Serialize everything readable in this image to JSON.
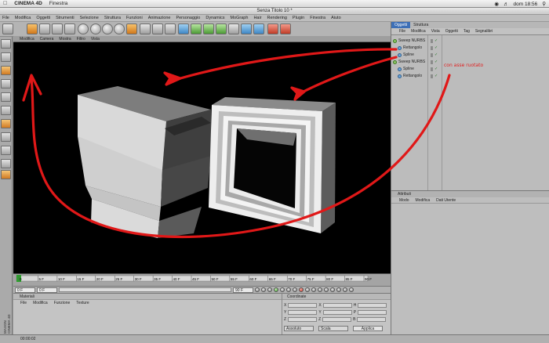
{
  "mac_menubar": {
    "apple": "",
    "app_name": "CINEMA 4D",
    "menu": "Finestra",
    "clock": "dom 18:56"
  },
  "window": {
    "title": "Senza Titolo 10 *"
  },
  "app_menu": [
    "File",
    "Modifica",
    "Oggetti",
    "Strumenti",
    "Selezione",
    "Struttura",
    "Funzioni",
    "Animazione",
    "Personaggio",
    "Dynamics",
    "MoGraph",
    "Hair",
    "Rendering",
    "Plugin",
    "Finestra",
    "Aiuto"
  ],
  "viewport_menu": [
    "Modifica",
    "Camera",
    "Mostra",
    "Filtro",
    "Vista"
  ],
  "timeline": {
    "ticks": [
      "0",
      "5 F",
      "10 F",
      "15 F",
      "20 F",
      "25 F",
      "30 F",
      "35 F",
      "40 F",
      "45 F",
      "50 F",
      "55 F",
      "60 F",
      "65 F",
      "70 F",
      "75 F",
      "80 F",
      "85 F",
      "90 F"
    ],
    "current_field": "0 F",
    "start_field": "0 F",
    "end_field": "90 F",
    "current_frame": 0
  },
  "materials": {
    "title": "Materiali",
    "menu": [
      "File",
      "Modifica",
      "Funzione",
      "Texture"
    ]
  },
  "coordinates": {
    "title": "Coordinate",
    "rows": [
      {
        "a": "X",
        "b": "X",
        "c": "H"
      },
      {
        "a": "Y",
        "b": "Y",
        "c": "P"
      },
      {
        "a": "Z",
        "b": "Z",
        "c": "B"
      }
    ],
    "mode_select": "Assoluto",
    "size_select": "Scala",
    "apply_button": "Applica"
  },
  "objects": {
    "tabs": [
      "Oggetti",
      "Struttura"
    ],
    "menu": [
      "File",
      "Modifica",
      "Vista",
      "Oggetti",
      "Tag",
      "Segnalibri"
    ],
    "rows": [
      {
        "name": "Sweep NURBS",
        "level": 0,
        "icon": "sweep-nurbs-icon"
      },
      {
        "name": "Rettangolo",
        "level": 1,
        "icon": "spline-icon"
      },
      {
        "name": "Spline",
        "level": 1,
        "icon": "spline-icon"
      },
      {
        "name": "Sweep NURBS",
        "level": 0,
        "icon": "sweep-nurbs-icon"
      },
      {
        "name": "Spline",
        "level": 1,
        "icon": "spline-icon"
      },
      {
        "name": "Rettangolo",
        "level": 1,
        "icon": "spline-icon"
      }
    ]
  },
  "attributes": {
    "title": "Attributi",
    "menu": [
      "Modo",
      "Modifica",
      "Dati Utente"
    ]
  },
  "statusbar": {
    "time": "00:00:02"
  },
  "logo": "MAXON CINEMA 4D",
  "annotation": "con asse ruotato",
  "colors": {
    "annotation": "#e02020",
    "active_tab": "#3d6fb6",
    "viewport_bg": "#000000"
  }
}
